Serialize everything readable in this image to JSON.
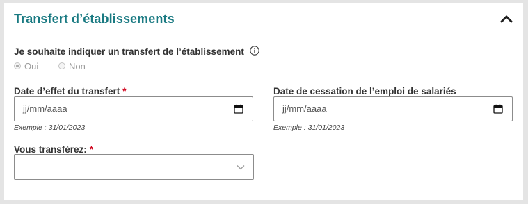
{
  "section": {
    "title": "Transfert d’établissements",
    "toggle_icon": "chevron-up-icon"
  },
  "transfer_question": {
    "label": "Je souhaite indiquer un transfert de l’établissement",
    "info_icon": "info-icon",
    "options": [
      {
        "label": "Oui",
        "selected": true,
        "disabled": true
      },
      {
        "label": "Non",
        "selected": false,
        "disabled": true
      }
    ]
  },
  "effective_date": {
    "label": "Date d’effet du transfert",
    "required_mark": "*",
    "placeholder": "jj/mm/aaaa",
    "value": "",
    "icon": "calendar-icon",
    "hint": "Exemple : 31/01/2023"
  },
  "cessation_date": {
    "label": "Date de cessation de l’emploi de salariés",
    "placeholder": "jj/mm/aaaa",
    "value": "",
    "icon": "calendar-icon",
    "hint": "Exemple : 31/01/2023"
  },
  "transfer_select": {
    "label": "Vous transférez:",
    "required_mark": "*",
    "selected_value": "",
    "icon": "chevron-down-icon"
  },
  "colors": {
    "title": "#1a7a82",
    "required": "#d0021b",
    "page_background": "#e4e4e4",
    "panel_background": "#ffffff"
  }
}
